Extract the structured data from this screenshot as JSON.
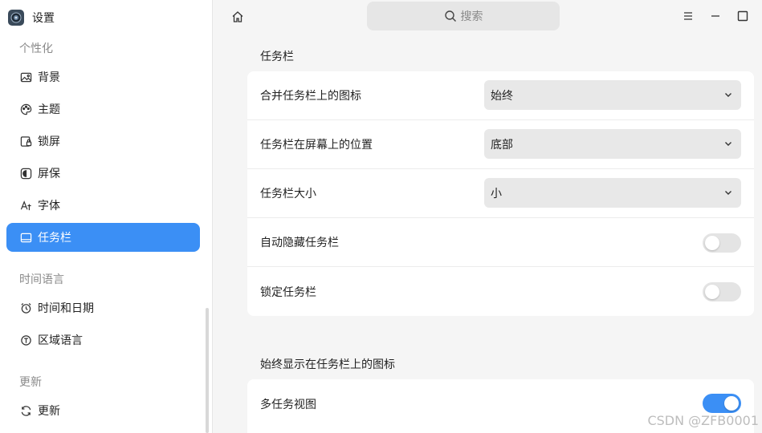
{
  "app": {
    "title": "设置"
  },
  "sidebar": {
    "groups": [
      {
        "label": "个性化"
      },
      {
        "label": "时间语言"
      },
      {
        "label": "更新"
      }
    ],
    "items": [
      {
        "label": "背景",
        "icon": "image-icon"
      },
      {
        "label": "主题",
        "icon": "palette-icon"
      },
      {
        "label": "锁屏",
        "icon": "lock-screen-icon"
      },
      {
        "label": "屏保",
        "icon": "screensaver-icon"
      },
      {
        "label": "字体",
        "icon": "font-icon"
      },
      {
        "label": "任务栏",
        "icon": "taskbar-icon",
        "active": true
      },
      {
        "label": "时间和日期",
        "icon": "clock-icon"
      },
      {
        "label": "区域语言",
        "icon": "region-icon"
      },
      {
        "label": "更新",
        "icon": "refresh-icon"
      }
    ]
  },
  "search": {
    "placeholder": "搜索"
  },
  "content": {
    "sections": [
      {
        "title": "任务栏",
        "rows": [
          {
            "label": "合并任务栏上的图标",
            "type": "select",
            "value": "始终"
          },
          {
            "label": "任务栏在屏幕上的位置",
            "type": "select",
            "value": "底部"
          },
          {
            "label": "任务栏大小",
            "type": "select",
            "value": "小"
          },
          {
            "label": "自动隐藏任务栏",
            "type": "toggle",
            "on": false
          },
          {
            "label": "锁定任务栏",
            "type": "toggle",
            "on": false
          }
        ]
      },
      {
        "title": "始终显示在任务栏上的图标",
        "rows": [
          {
            "label": "多任务视图",
            "type": "toggle",
            "on": true
          }
        ]
      }
    ]
  },
  "colors": {
    "accent": "#3b8ff5",
    "sidebar_bg": "#ffffff",
    "content_bg": "#f5f5f5"
  },
  "watermark": "CSDN @ZFB0001"
}
